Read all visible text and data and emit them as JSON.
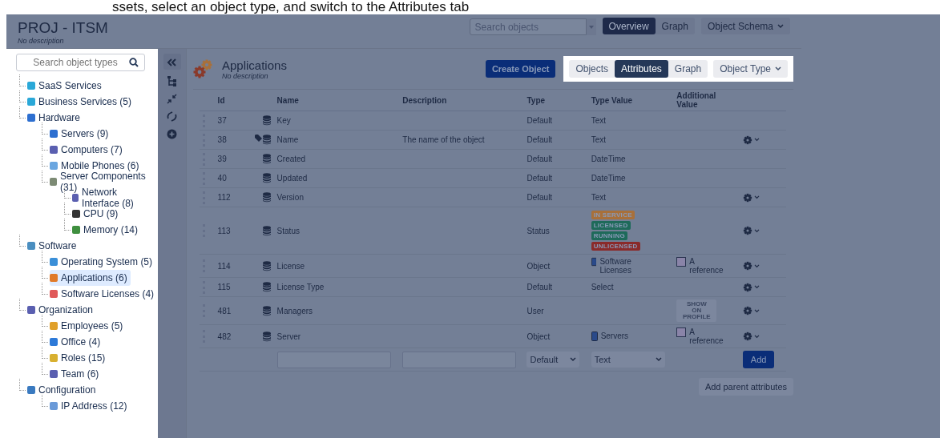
{
  "caption": "ssets, select an object type, and switch to the Attributes tab",
  "header": {
    "title": "PROJ - ITSM",
    "description": "No description",
    "search": {
      "placeholder": "Search objects"
    },
    "tabs": [
      {
        "label": "Overview",
        "selected": true
      },
      {
        "label": "Graph",
        "selected": false
      }
    ],
    "menu": "Object Schema"
  },
  "sidebar": {
    "search": {
      "placeholder": "Search object types"
    },
    "items": [
      {
        "label": "SaaS Services",
        "color": "#2aa8d8",
        "selected": false
      },
      {
        "label": "Business Services (5)",
        "color": "#2aa8d8",
        "selected": false
      },
      {
        "label": "Hardware",
        "color": "#2d6fd0",
        "selected": false,
        "children": [
          {
            "label": "Servers (9)",
            "color": "#2d6fd0",
            "selected": false
          },
          {
            "label": "Computers (7)",
            "color": "#5a5fb0",
            "selected": false
          },
          {
            "label": "Mobile Phones (6)",
            "color": "#6aa6e0",
            "selected": false
          },
          {
            "label": "Server Components (31)",
            "color": "#7c8a74",
            "selected": false,
            "children": [
              {
                "label": "Network Interface (8)",
                "color": "#5a5fb0",
                "selected": false
              },
              {
                "label": "CPU (9)",
                "color": "#333333",
                "selected": false
              },
              {
                "label": "Memory (14)",
                "color": "#3f8f3f",
                "selected": false
              }
            ]
          }
        ]
      },
      {
        "label": "Software",
        "color": "#4a8ec0",
        "selected": false,
        "children": [
          {
            "label": "Operating System (5)",
            "color": "#3a8fd8",
            "selected": false
          },
          {
            "label": "Applications (6)",
            "color": "#e07a2a",
            "selected": true
          },
          {
            "label": "Software Licenses (4)",
            "color": "#e05a5a",
            "selected": false
          }
        ]
      },
      {
        "label": "Organization",
        "color": "#5a5fb0",
        "selected": false,
        "children": [
          {
            "label": "Employees (5)",
            "color": "#e0a02a",
            "selected": false
          },
          {
            "label": "Office (4)",
            "color": "#2d7ad8",
            "selected": false
          },
          {
            "label": "Roles (15)",
            "color": "#d8b030",
            "selected": false
          },
          {
            "label": "Team (6)",
            "color": "#5a5fb0",
            "selected": false
          }
        ]
      },
      {
        "label": "Configuration",
        "color": "#3a7ac0",
        "selected": false,
        "children": [
          {
            "label": "IP Address (12)",
            "color": "#6a9ad8",
            "selected": false
          }
        ]
      }
    ]
  },
  "main": {
    "title": "Applications",
    "description": "No description",
    "create_button": "Create Object",
    "tabs": [
      {
        "label": "Objects",
        "selected": false
      },
      {
        "label": "Attributes",
        "selected": true
      },
      {
        "label": "Graph",
        "selected": false
      }
    ],
    "menu": "Object Type",
    "table": {
      "columns": [
        "Id",
        "Name",
        "Description",
        "Type",
        "Type Value",
        "Additional Value"
      ],
      "rows": [
        {
          "id": "37",
          "name": "Key",
          "type": "Default",
          "type_value": {
            "kind": "text",
            "text": "Text"
          },
          "label": false,
          "menu": false
        },
        {
          "id": "38",
          "name": "Name",
          "description": "The name of the object",
          "type": "Default",
          "type_value": {
            "kind": "text",
            "text": "Text"
          },
          "label": true,
          "menu": true
        },
        {
          "id": "39",
          "name": "Created",
          "type": "Default",
          "type_value": {
            "kind": "text",
            "text": "DateTime"
          },
          "label": false,
          "menu": false
        },
        {
          "id": "40",
          "name": "Updated",
          "type": "Default",
          "type_value": {
            "kind": "text",
            "text": "DateTime"
          },
          "label": false,
          "menu": false
        },
        {
          "id": "112",
          "name": "Version",
          "type": "Default",
          "type_value": {
            "kind": "text",
            "text": "Text"
          },
          "label": false,
          "menu": true
        },
        {
          "id": "113",
          "name": "Status",
          "type": "Status",
          "type_value": {
            "kind": "statuses",
            "statuses": [
              {
                "text": "IN SERVICE",
                "color": "#a8703a"
              },
              {
                "text": "LICENSED",
                "color": "#1e6a5a"
              },
              {
                "text": "RUNNING",
                "color": "#1e6a5a"
              },
              {
                "text": "UNLICENSED",
                "color": "#8a2a2a"
              }
            ]
          },
          "label": false,
          "menu": true
        },
        {
          "id": "114",
          "name": "License",
          "type": "Object",
          "type_value": {
            "kind": "reference",
            "text": "Software Licenses"
          },
          "additional": {
            "kind": "reference",
            "text": "A reference"
          },
          "label": false,
          "menu": true
        },
        {
          "id": "115",
          "name": "License Type",
          "type": "Default",
          "type_value": {
            "kind": "text",
            "text": "Select"
          },
          "label": false,
          "menu": true
        },
        {
          "id": "481",
          "name": "Managers",
          "type": "User",
          "additional": {
            "kind": "lozenge",
            "text": "SHOW ON PROFILE"
          },
          "label": false,
          "menu": true
        },
        {
          "id": "482",
          "name": "Server",
          "type": "Object",
          "type_value": {
            "kind": "reference",
            "text": "Servers"
          },
          "additional": {
            "kind": "reference",
            "text": "A reference"
          },
          "label": false,
          "menu": true
        }
      ],
      "new_row": {
        "type": "Default",
        "type_value": "Text",
        "button": "Add"
      }
    },
    "parent_button": "Add parent attributes"
  }
}
